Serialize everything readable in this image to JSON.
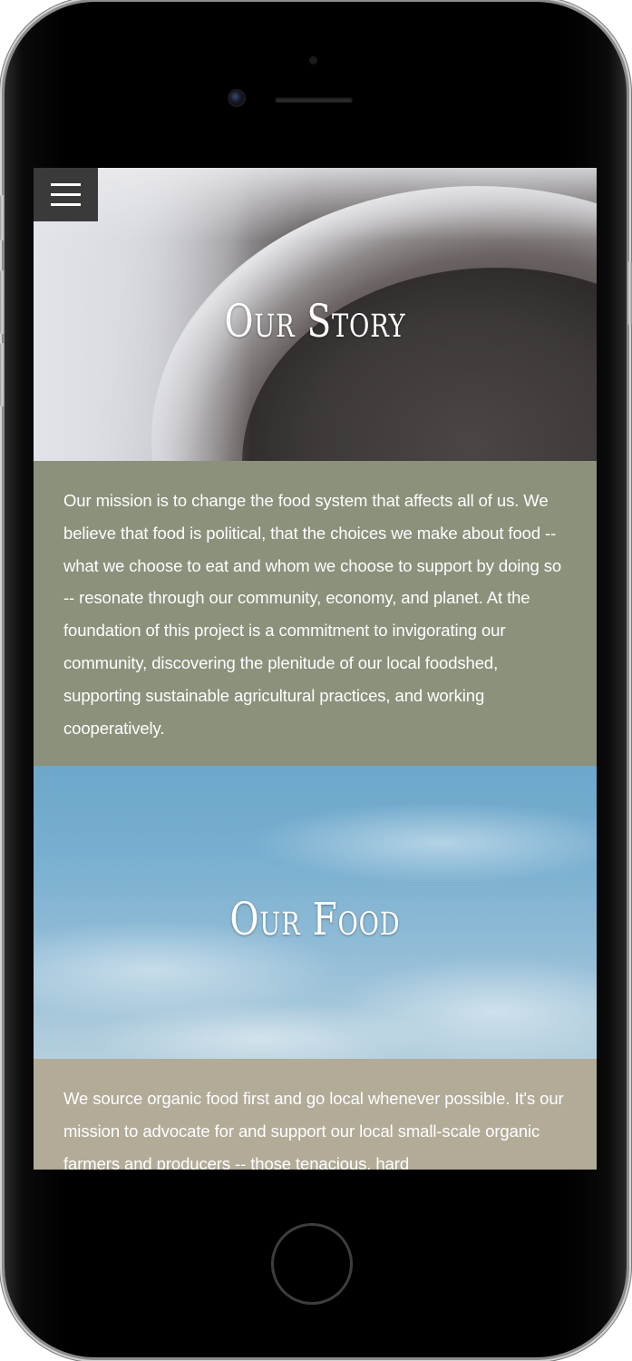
{
  "story": {
    "title": "Our Story",
    "text": "Our mission is to change the food system that affects all of us. We believe that food is political, that the choices we make about food -- what we choose to eat and whom we choose to support by doing so -- resonate through our community, economy, and planet. At the foundation of this project is a commitment to invigorating our community, discovering the plenitude of our local foodshed, supporting sustainable agricultural practices, and working cooperatively."
  },
  "food": {
    "title": "Our Food",
    "text": "We source organic food first and go local whenever possible. It's our mission to advocate for and support our local small-scale organic farmers and producers -- those tenacious, hard"
  },
  "menu": {
    "icon": "hamburger-menu-icon"
  },
  "colors": {
    "story_text_bg": "#8b917b",
    "food_text_bg": "#b2ab98",
    "menu_bg": "#3a3a3a"
  }
}
